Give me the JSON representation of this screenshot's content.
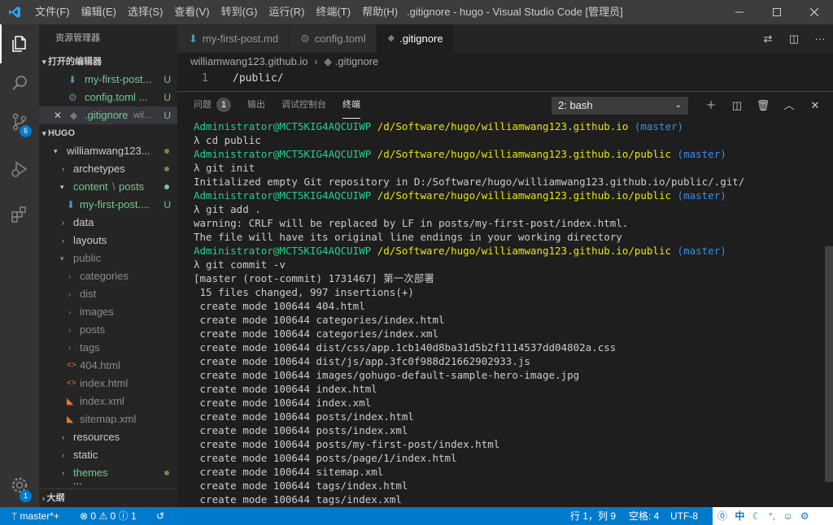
{
  "window": {
    "title": ".gitignore - hugo - Visual Studio Code [管理员]"
  },
  "menu": [
    "文件(F)",
    "编辑(E)",
    "选择(S)",
    "查看(V)",
    "转到(G)",
    "运行(R)",
    "终端(T)",
    "帮助(H)"
  ],
  "activity": {
    "scm_badge": "6",
    "settings_badge": "1"
  },
  "sidebar": {
    "title": "资源管理器",
    "open_editors_header": "打开的编辑器",
    "open_editors": [
      {
        "label": "my-first-post...",
        "status": "U"
      },
      {
        "label": "config.toml ...",
        "status": "U"
      },
      {
        "label": ".gitignore",
        "hint": "wil...",
        "status": "U"
      }
    ],
    "hugo_header": "HUGO",
    "tree": [
      {
        "label": "williamwang123..."
      },
      {
        "label": "archetypes"
      },
      {
        "label": "content",
        "sep": "\\",
        "label2": "posts"
      },
      {
        "label": "my-first-post....",
        "status": "U"
      },
      {
        "label": "data"
      },
      {
        "label": "layouts"
      },
      {
        "label": "public"
      },
      {
        "label": "categories"
      },
      {
        "label": "dist"
      },
      {
        "label": "images"
      },
      {
        "label": "posts"
      },
      {
        "label": "tags"
      },
      {
        "label": "404.html"
      },
      {
        "label": "index.html"
      },
      {
        "label": "index.xml"
      },
      {
        "label": "sitemap.xml"
      },
      {
        "label": "resources"
      },
      {
        "label": "static"
      },
      {
        "label": "themes"
      },
      {
        "label": "..."
      }
    ],
    "outline_header": "大纲"
  },
  "tabs": [
    {
      "label": "my-first-post.md"
    },
    {
      "label": "config.toml"
    },
    {
      "label": ".gitignore"
    }
  ],
  "breadcrumb": {
    "folder": "williamwang123.github.io",
    "sep": "›",
    "file": ".gitignore"
  },
  "editor": {
    "line_number": "1",
    "line_text": "/public/"
  },
  "panel": {
    "tabs": [
      "问题",
      "输出",
      "调试控制台",
      "终端"
    ],
    "problems_count": "1",
    "terminal_select": "2: bash"
  },
  "terminal": {
    "lines": [
      {
        "prompt": true,
        "user": "Administrator@MCT5KIG4AQCUIWP",
        "path": "/d/Software/hugo/williamwang123.github.io",
        "branch": "(master)"
      },
      {
        "text": "λ cd public"
      },
      {
        "prompt": true,
        "user": "Administrator@MCT5KIG4AQCUIWP",
        "path": "/d/Software/hugo/williamwang123.github.io/public",
        "branch": "(master)"
      },
      {
        "text": "λ git init"
      },
      {
        "text": "Initialized empty Git repository in D:/Software/hugo/williamwang123.github.io/public/.git/"
      },
      {
        "prompt": true,
        "user": "Administrator@MCT5KIG4AQCUIWP",
        "path": "/d/Software/hugo/williamwang123.github.io/public",
        "branch": "(master)"
      },
      {
        "text": "λ git add ."
      },
      {
        "text": "warning: CRLF will be replaced by LF in posts/my-first-post/index.html."
      },
      {
        "text": "The file will have its original line endings in your working directory"
      },
      {
        "prompt": true,
        "user": "Administrator@MCT5KIG4AQCUIWP",
        "path": "/d/Software/hugo/williamwang123.github.io/public",
        "branch": "(master)"
      },
      {
        "text": "λ git commit -v"
      },
      {
        "text": "[master (root-commit) 1731467] 第一次部署"
      },
      {
        "text": " 15 files changed, 997 insertions(+)"
      },
      {
        "text": " create mode 100644 404.html"
      },
      {
        "text": " create mode 100644 categories/index.html"
      },
      {
        "text": " create mode 100644 categories/index.xml"
      },
      {
        "text": " create mode 100644 dist/css/app.1cb140d8ba31d5b2f1114537dd04802a.css"
      },
      {
        "text": " create mode 100644 dist/js/app.3fc0f988d21662902933.js"
      },
      {
        "text": " create mode 100644 images/gohugo-default-sample-hero-image.jpg"
      },
      {
        "text": " create mode 100644 index.html"
      },
      {
        "text": " create mode 100644 index.xml"
      },
      {
        "text": " create mode 100644 posts/index.html"
      },
      {
        "text": " create mode 100644 posts/index.xml"
      },
      {
        "text": " create mode 100644 posts/my-first-post/index.html"
      },
      {
        "text": " create mode 100644 posts/page/1/index.html"
      },
      {
        "text": " create mode 100644 sitemap.xml"
      },
      {
        "text": " create mode 100644 tags/index.html"
      },
      {
        "text": " create mode 100644 tags/index.xml"
      }
    ]
  },
  "statusbar": {
    "branch": "master*+",
    "errors": "0",
    "warnings": "0",
    "info": "1",
    "position": "行 1，列 9",
    "indent": "空格: 4",
    "encoding": "UTF-8",
    "ime": "中"
  },
  "colors": {
    "accent": "#007acc",
    "git_untracked": "#73c991",
    "prompt_user": "#23d18b",
    "prompt_path": "#e5e510",
    "prompt_branch": "#3b8eea"
  }
}
